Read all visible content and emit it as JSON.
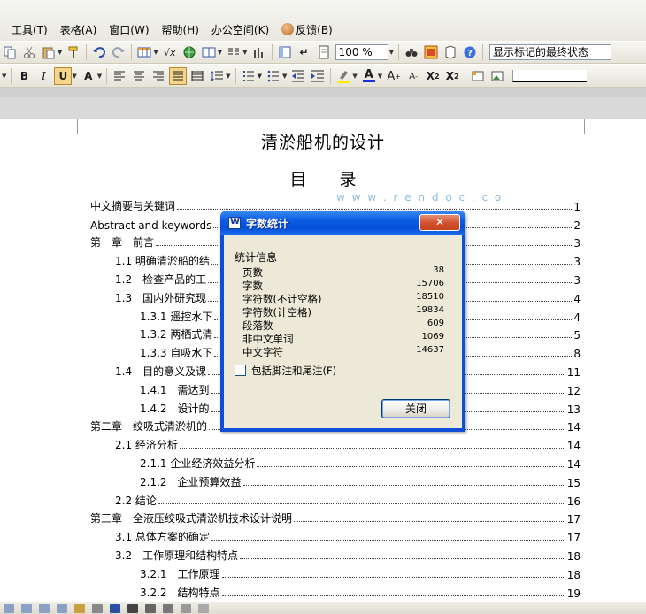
{
  "menu": {
    "items": [
      "工具(T)",
      "表格(A)",
      "窗口(W)",
      "帮助(H)",
      "办公空间(K)",
      "反馈(B)"
    ]
  },
  "toolbar1": {
    "zoom": "100 %",
    "track_state": "显示标记的最终状态"
  },
  "toolbar2": {
    "bold": "B",
    "italic": "I",
    "underline": "U",
    "char_scale": "A",
    "font_color": "A",
    "grow_font": "A",
    "shrink_font": "A",
    "superscript": "X",
    "subscript": "X"
  },
  "document": {
    "title": "清淤船机的设计",
    "toc_title_chars": [
      "目",
      "录"
    ],
    "toc": [
      {
        "label": "中文摘要与关键词",
        "page": "1",
        "level": 1
      },
      {
        "label": "Abstract and keywords",
        "page": "2",
        "level": 1
      },
      {
        "label": "第一章　前言",
        "page": "3",
        "level": 1
      },
      {
        "label": "1.1 明确清淤船的结",
        "page": "3",
        "level": 2
      },
      {
        "label": "1.2　检查产品的工",
        "page": "3",
        "level": 2
      },
      {
        "label": "1.3　国内外研究现",
        "page": "4",
        "level": 2
      },
      {
        "label": "1.3.1 遥控水下",
        "page": "4",
        "level": 3
      },
      {
        "label": "1.3.2 两栖式清",
        "page": "5",
        "level": 3
      },
      {
        "label": "1.3.3 自吸水下",
        "page": "8",
        "level": 3
      },
      {
        "label": "1.4　目的意义及课",
        "page": "11",
        "level": 2
      },
      {
        "label": "1.4.1　需达到",
        "page": "12",
        "level": 3
      },
      {
        "label": "1.4.2　设计的",
        "page": "13",
        "level": 3
      },
      {
        "label": "第二章　绞吸式清淤机的",
        "page": "14",
        "level": 1
      },
      {
        "label": "2.1 经济分析",
        "page": "14",
        "level": 2
      },
      {
        "label": "2.1.1 企业经济效益分析",
        "page": "14",
        "level": 3
      },
      {
        "label": "2.1.2　企业预算效益",
        "page": "15",
        "level": 3
      },
      {
        "label": "2.2 结论",
        "page": "16",
        "level": 2
      },
      {
        "label": "第三章　全液压绞吸式清淤机技术设计说明",
        "page": "17",
        "level": 1
      },
      {
        "label": "3.1 总体方案的确定",
        "page": "17",
        "level": 2
      },
      {
        "label": "3.2　工作原理和结构特点",
        "page": "18",
        "level": 2
      },
      {
        "label": "3.2.1　工作原理",
        "page": "18",
        "level": 3
      },
      {
        "label": "3.2.2　结构特点",
        "page": "19",
        "level": 3
      }
    ],
    "watermark_url": "w w w . r e n d o c . c o"
  },
  "dialog": {
    "title": "字数统计",
    "group_label": "统计信息",
    "stats": [
      {
        "name": "页数",
        "value": "38"
      },
      {
        "name": "字数",
        "value": "15706"
      },
      {
        "name": "字符数(不计空格)",
        "value": "18510"
      },
      {
        "name": "字符数(计空格)",
        "value": "19834"
      },
      {
        "name": "段落数",
        "value": "609"
      },
      {
        "name": "非中文单词",
        "value": "1069"
      },
      {
        "name": "中文字符",
        "value": "14637"
      }
    ],
    "checkbox_label": "包括脚注和尾注(F)",
    "checkbox_checked": false,
    "close_button": "关闭"
  }
}
